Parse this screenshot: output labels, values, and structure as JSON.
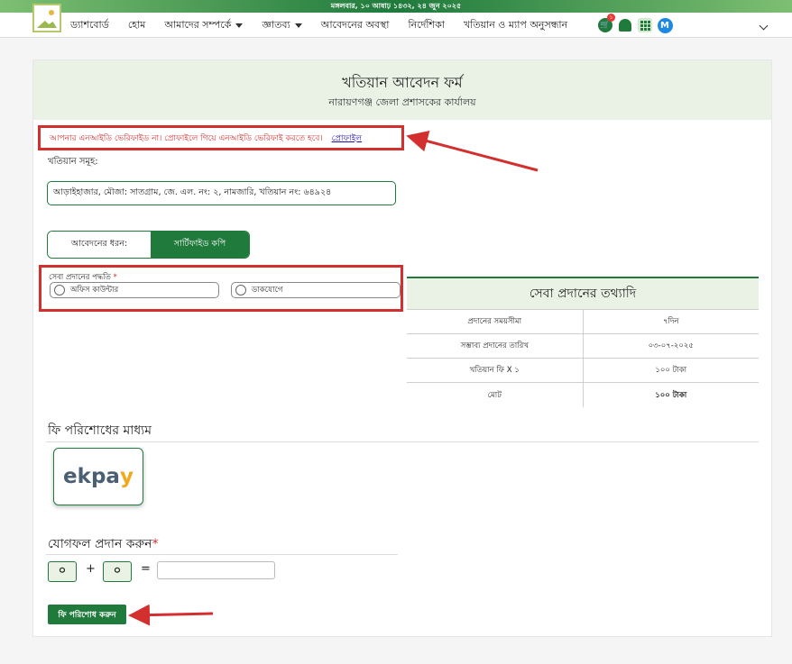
{
  "topbar": {
    "date_text": "মঙ্গলবার, ১০ আষাঢ় ১৪৩২, ২৪ জুন ২০২৫"
  },
  "nav": {
    "items": [
      {
        "label": "ড্যাশবোর্ড",
        "caret": false
      },
      {
        "label": "হোম",
        "caret": false
      },
      {
        "label": "আমাদের সম্পর্কে",
        "caret": true
      },
      {
        "label": "জ্ঞাতব্য",
        "caret": true
      },
      {
        "label": "আবেদনের অবস্থা",
        "caret": false
      },
      {
        "label": "নির্দেশিকা",
        "caret": false
      },
      {
        "label": "খতিয়ান ও ম্যাপ অনুসন্ধান",
        "caret": false
      }
    ],
    "cart_count": "১",
    "avatar_letter": "M"
  },
  "form": {
    "title": "খতিয়ান আবেদন ফর্ম",
    "subtitle": "নারায়ণগঞ্জ জেলা প্রশাসকের কার্যালয়",
    "warning_text": "আপনার এনআইডি ভেরিফাইড না। প্রোফাইলে গিয়ে এনআইডি ভেরিফাই করতে হবে।",
    "warning_link": "প্রোফাইল",
    "khatian_label": "খতিয়ান সমূহ:",
    "khatian_value": "আড়াইহাজার, মৌজা: সাতগ্রাম, জে. এল. নং: ২, নামজারি, খতিয়ান নং: ৬৪৯২৪",
    "application_type_label": "আবেদনের ধরন:",
    "application_type_value": "সার্টিফাইড কপি",
    "delivery_method_label": "সেবা প্রদানের পদ্ধতি",
    "delivery_required": "*",
    "delivery_options": [
      "অফিস কাউন্টার",
      "ডাকযোগে"
    ]
  },
  "service_info": {
    "title": "সেবা প্রদানের তথ্যাদি",
    "rows": [
      {
        "label": "প্রদানের সময়সীমা",
        "value": "৭দিন"
      },
      {
        "label": "সম্ভাব্য প্রদানের তারিখ",
        "value": "০৩-০৭-২০২৫"
      },
      {
        "label": "খতিয়ান ফি X ১",
        "value": "১০০ টাকা"
      },
      {
        "label": "মোট",
        "value": "১০০ টাকা"
      }
    ]
  },
  "payment": {
    "section_title": "ফি পরিশোধের মাধ্যম",
    "method_logo_part1": "ekpa",
    "method_logo_part2": "y"
  },
  "captcha": {
    "title": "যোগফল প্রদান করুন",
    "required": "*",
    "a": "০",
    "op": "+",
    "b": "০",
    "eq": "=",
    "answer": ""
  },
  "submit": {
    "label": "ফি পরিশোধ করুন"
  },
  "colors": {
    "brand_green": "#1f7a3c",
    "alert_red": "#d32f2f",
    "header_bg": "#eaf2e6"
  }
}
